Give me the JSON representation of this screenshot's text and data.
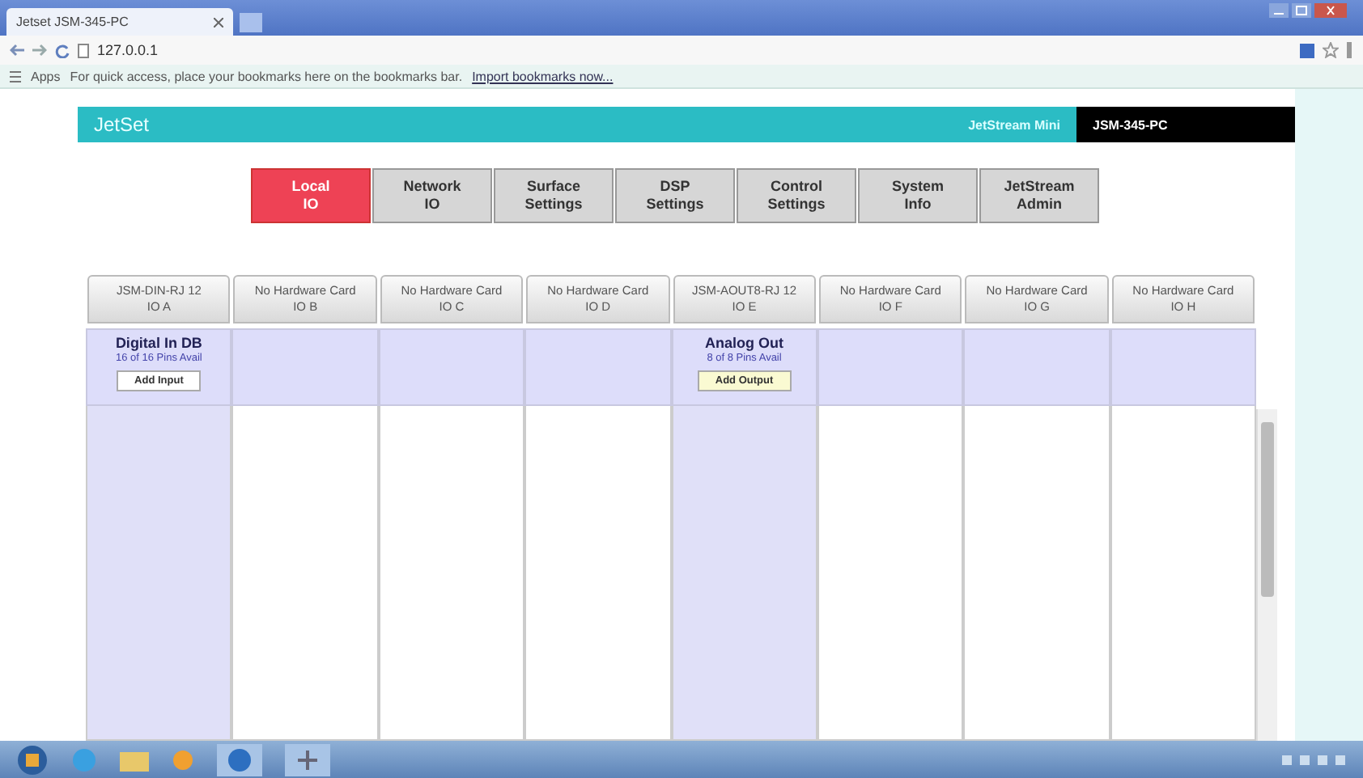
{
  "browser": {
    "tab_title": "Jetset JSM-345-PC",
    "address": "127.0.0.1",
    "bookmarks_apps": "Apps",
    "bookmarks_hint": "For quick access, place your bookmarks here on the bookmarks bar.",
    "bookmarks_link": "Import bookmarks now..."
  },
  "app": {
    "brand": "JetSet",
    "product": "JetStream Mini",
    "device": "JSM-345-PC"
  },
  "tabs": [
    {
      "line1": "Local",
      "line2": "IO",
      "selected": true
    },
    {
      "line1": "Network",
      "line2": "IO",
      "selected": false
    },
    {
      "line1": "Surface",
      "line2": "Settings",
      "selected": false
    },
    {
      "line1": "DSP",
      "line2": "Settings",
      "selected": false
    },
    {
      "line1": "Control",
      "line2": "Settings",
      "selected": false
    },
    {
      "line1": "System",
      "line2": "Info",
      "selected": false
    },
    {
      "line1": "JetStream",
      "line2": "Admin",
      "selected": false
    }
  ],
  "columns": [
    {
      "card": "JSM-DIN-RJ 12",
      "slot": "IO A",
      "module": {
        "kind": "input",
        "name": "Digital In DB",
        "pins": "16 of 16 Pins Avail",
        "button": "Add Input"
      }
    },
    {
      "card": "No Hardware Card",
      "slot": "IO B"
    },
    {
      "card": "No Hardware Card",
      "slot": "IO C"
    },
    {
      "card": "No Hardware Card",
      "slot": "IO D"
    },
    {
      "card": "JSM-AOUT8-RJ 12",
      "slot": "IO E",
      "module": {
        "kind": "output",
        "name": "Analog Out",
        "pins": "8 of 8 Pins Avail",
        "button": "Add Output"
      }
    },
    {
      "card": "No Hardware Card",
      "slot": "IO F"
    },
    {
      "card": "No Hardware Card",
      "slot": "IO G"
    },
    {
      "card": "No Hardware Card",
      "slot": "IO H"
    }
  ]
}
